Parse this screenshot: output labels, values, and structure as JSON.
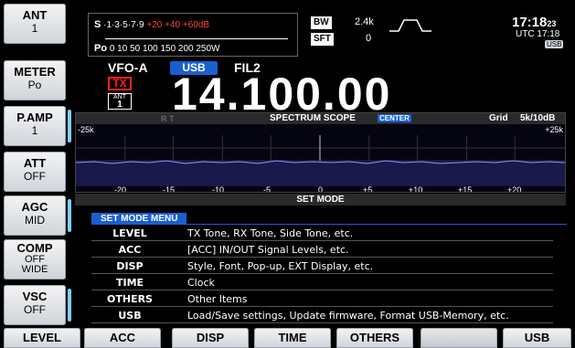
{
  "side_buttons": [
    {
      "title": "ANT",
      "value": "1"
    },
    {
      "title": "METER",
      "value": "Po"
    },
    {
      "title": "P.AMP",
      "value": "1"
    },
    {
      "title": "ATT",
      "value": "OFF"
    },
    {
      "title": "AGC",
      "value": "MID"
    },
    {
      "title": "COMP",
      "value": "OFF",
      "value2": "WIDE"
    },
    {
      "title": "VSC",
      "value": "OFF"
    }
  ],
  "meter": {
    "s_label": "S",
    "s_scale": "·1·3·5·7·9",
    "s_over": "+20 +40 +60dB",
    "po_label": "Po",
    "po_scale": "0   10      50     100 150 200 250W"
  },
  "bw": {
    "label": "BW",
    "value": "2.4k"
  },
  "sft": {
    "label": "SFT",
    "value": "0"
  },
  "clock": {
    "time": "17:18",
    "seconds": "23",
    "utc": "UTC 17:18",
    "usb_tag": "USB"
  },
  "vfo": {
    "name": "VFO-A",
    "mode": "USB",
    "filter": "FIL2",
    "tx": "TX",
    "ant_label": "ANT",
    "ant_num": "1"
  },
  "frequency": "14.100.00",
  "scope": {
    "rt": "R T",
    "title": "SPECTRUM SCOPE",
    "center": "CENTER",
    "grid": "Grid",
    "span": "5k/10dB",
    "left_edge": "-25k",
    "right_edge": "+25k",
    "ticks": [
      "-20",
      "-15",
      "-10",
      "-5",
      "0",
      "+5",
      "+10",
      "+15",
      "+20"
    ]
  },
  "set_mode": {
    "title": "SET MODE",
    "menu": "SET MODE MENU",
    "items": [
      {
        "key": "LEVEL",
        "desc": "TX Tone, RX Tone, Side Tone, etc."
      },
      {
        "key": "ACC",
        "desc": "[ACC] IN/OUT Signal Levels, etc."
      },
      {
        "key": "DISP",
        "desc": "Style, Font, Pop-up, EXT Display, etc."
      },
      {
        "key": "TIME",
        "desc": "Clock"
      },
      {
        "key": "OTHERS",
        "desc": "Other Items"
      },
      {
        "key": "USB",
        "desc": "Load/Save settings, Update firmware, Format USB-Memory, etc."
      }
    ]
  },
  "bottom_buttons": [
    "LEVEL",
    "ACC",
    "DISP",
    "TIME",
    "OTHERS",
    "",
    "USB"
  ]
}
